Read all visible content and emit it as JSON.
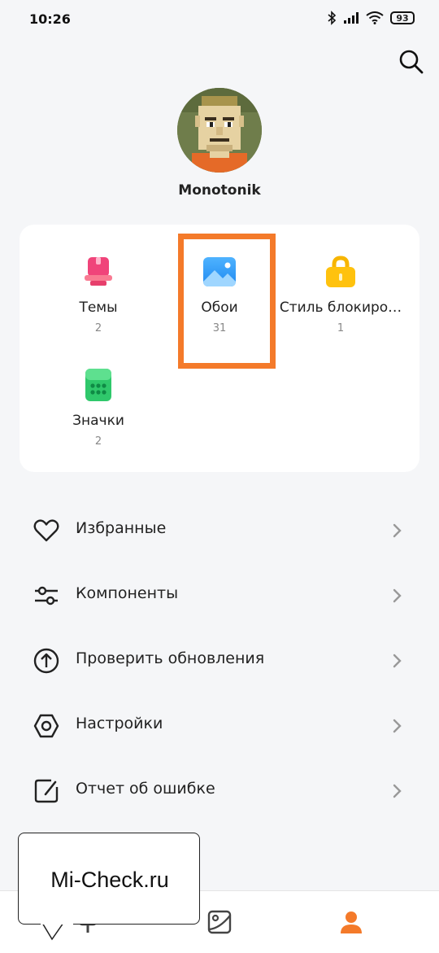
{
  "status_bar": {
    "time": "10:26",
    "battery": "93"
  },
  "profile": {
    "name": "Monotonik"
  },
  "categories": [
    {
      "label": "Темы",
      "count": "2"
    },
    {
      "label": "Обои",
      "count": "31"
    },
    {
      "label": "Стиль блокиро…",
      "count": "1"
    },
    {
      "label": "Значки",
      "count": "2"
    }
  ],
  "menu": [
    {
      "label": "Избранные",
      "icon": "heart-icon"
    },
    {
      "label": "Компоненты",
      "icon": "sliders-icon"
    },
    {
      "label": "Проверить обновления",
      "icon": "update-arrow-icon"
    },
    {
      "label": "Настройки",
      "icon": "settings-hexagon-icon"
    },
    {
      "label": "Отчет об ошибке",
      "icon": "feedback-pencil-icon"
    }
  ],
  "bottom_nav": [
    "themes-tab",
    "wallpapers-tab",
    "profile-tab"
  ],
  "watermark": {
    "text": "Mi-Check.ru"
  },
  "colors": {
    "accent": "#f47a2a",
    "background": "#f5f6f8"
  }
}
